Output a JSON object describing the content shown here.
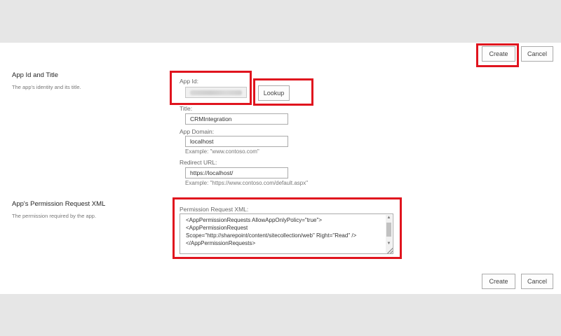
{
  "toolbar": {
    "create_label": "Create",
    "cancel_label": "Cancel"
  },
  "app_id_section": {
    "title": "App Id and Title",
    "description": "The app's identity and its title."
  },
  "fields": {
    "app_id_label": "App Id:",
    "app_id_value": "",
    "lookup_label": "Lookup",
    "title_label": "Title:",
    "title_value": "CRMIntegration",
    "app_domain_label": "App Domain:",
    "app_domain_value": "localhost",
    "app_domain_example": "Example: \"www.contoso.com\"",
    "redirect_label": "Redirect URL:",
    "redirect_value": "https://localhost/",
    "redirect_example": "Example: \"https://www.contoso.com/default.aspx\""
  },
  "permission_section": {
    "title": "App's Permission Request XML",
    "description": "The permission required by the app.",
    "xml_label": "Permission Request XML:",
    "xml_lines": [
      "<AppPermissionRequests AllowAppOnlyPolicy=\"true\">",
      "<AppPermissionRequest",
      "Scope=\"http://sharepoint/content/sitecollection/web\" Right=\"Read\" />",
      "</AppPermissionRequests>"
    ]
  },
  "footer": {
    "create_label": "Create",
    "cancel_label": "Cancel"
  },
  "colors": {
    "highlight": "#e0141e",
    "page_background": "#e6e6e6",
    "panel_background": "#ffffff"
  }
}
